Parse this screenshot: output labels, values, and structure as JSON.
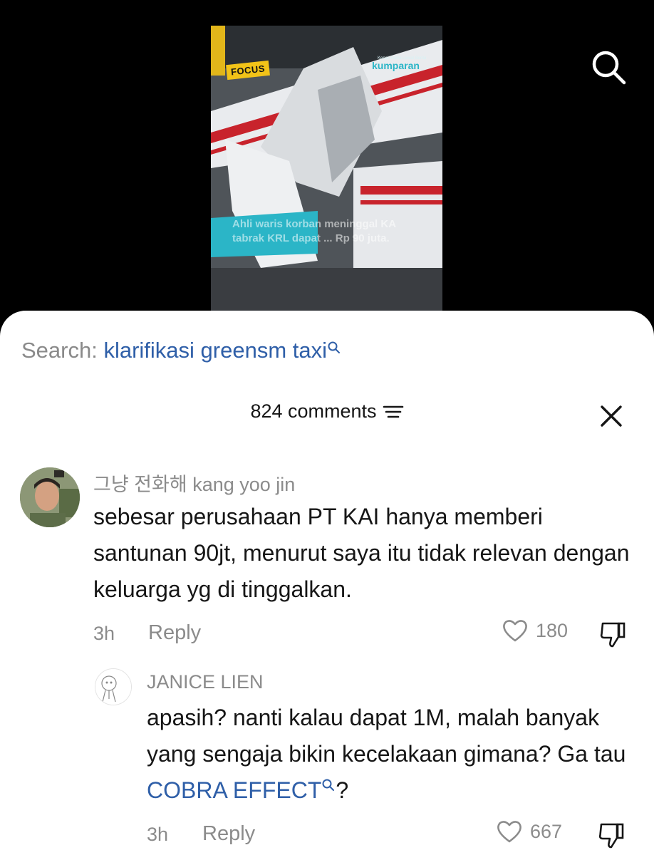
{
  "video": {
    "badge": "FOCUS",
    "brand": "kumparan",
    "brand_tagline": "Kenali Fakta Lewat Berita",
    "caption": "Ahli waris korban meninggal KA tabrak KRL dapat ... Rp 90 juta.",
    "search_icon": "search-icon"
  },
  "search_suggestion": {
    "prefix": "Search: ",
    "term": "klarifikasi greensm taxi"
  },
  "comments_header": {
    "count_label": "824 comments",
    "sort_icon": "sort-icon",
    "close_icon": "close-icon"
  },
  "comments": [
    {
      "username": "그냥 전화해 kang yoo jin",
      "text": "sebesar perusahaan PT KAI hanya memberi santunan 90jt, menurut saya itu tidak relevan dengan keluarga yg di tinggalkan.",
      "time": "3h",
      "reply_label": "Reply",
      "likes": "180"
    },
    {
      "username": "JANICE LIEN",
      "text_before": "apasih? nanti kalau dapat 1M, malah banyak yang sengaja bikin kecelakaan gimana? Ga tau ",
      "link_text": "COBRA EFFECT",
      "text_after": "?",
      "time": "3h",
      "reply_label": "Reply",
      "likes": "667"
    }
  ],
  "colors": {
    "link_blue": "#2f5fa8",
    "muted_gray": "#8b8b8b",
    "text_dark": "#161616",
    "brand_teal": "#2bb5c7",
    "badge_yellow": "#f2c318"
  }
}
